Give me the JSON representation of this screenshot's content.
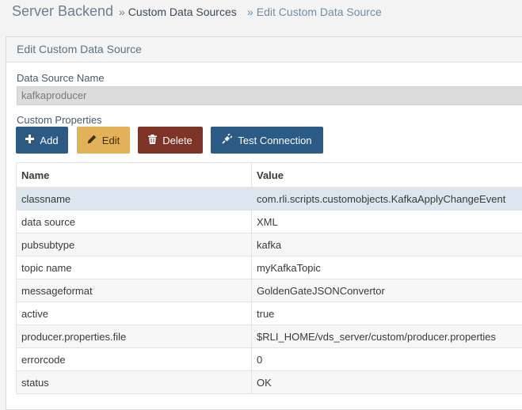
{
  "header": {
    "app_title": "Server Backend",
    "breadcrumb": [
      {
        "sep": "»",
        "label": "Custom Data Sources"
      },
      {
        "sep": "»",
        "label": "Edit Custom Data Source"
      }
    ]
  },
  "panel": {
    "title": "Edit Custom Data Source",
    "name_label": "Data Source Name",
    "name_value": "kafkaproducer",
    "props_label": "Custom Properties"
  },
  "toolbar": {
    "add_label": "Add",
    "edit_label": "Edit",
    "delete_label": "Delete",
    "test_label": "Test Connection"
  },
  "icons": {
    "add": "plus-icon",
    "edit": "pencil-icon",
    "delete": "trash-icon",
    "test": "plug-icon"
  },
  "table": {
    "columns": [
      "Name",
      "Value"
    ],
    "rows": [
      {
        "name": "classname",
        "value": "com.rli.scripts.customobjects.KafkaApplyChangeEvent"
      },
      {
        "name": "data source",
        "value": "XML"
      },
      {
        "name": "pubsubtype",
        "value": "kafka"
      },
      {
        "name": "topic name",
        "value": "myKafkaTopic"
      },
      {
        "name": "messageformat",
        "value": "GoldenGateJSONConvertor"
      },
      {
        "name": "active",
        "value": "true"
      },
      {
        "name": "producer.properties.file",
        "value": "$RLI_HOME/vds_server/custom/producer.properties"
      },
      {
        "name": "errorcode",
        "value": "0"
      },
      {
        "name": "status",
        "value": "OK"
      }
    ]
  },
  "colors": {
    "primary": "#2b5a84",
    "warning": "#e2b158",
    "danger": "#7d3427",
    "selected_row": "#dde6ee"
  }
}
